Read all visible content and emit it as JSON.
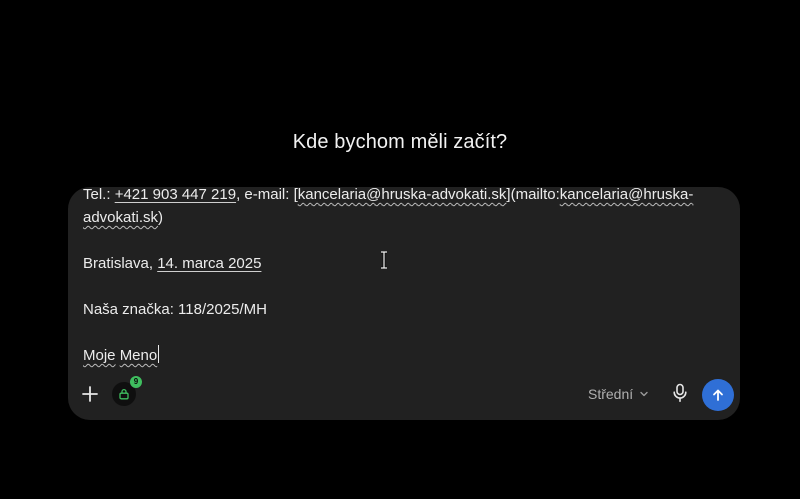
{
  "heading": "Kde bychom měli začít?",
  "composer": {
    "line1": {
      "prefix": "Tel.: ",
      "phone": "+421 903 447 219",
      "middle": ", e-mail: [",
      "email1": "kancelaria@hruska-advokati.sk",
      "bracket": "](mailto:",
      "email2a": "kancelaria@hruska-"
    },
    "line2": {
      "email2b": "advokati.sk",
      "suffix": ")"
    },
    "line3": {
      "city": "Bratislava, ",
      "date": "14. marca 2025"
    },
    "line4": "Naša značka: 118/2025/MH",
    "line5": {
      "word1": "Moje",
      "space": " ",
      "word2": "Meno"
    }
  },
  "toolbar": {
    "tool_badge": "9",
    "model_label": "Střední",
    "icons": {
      "plus": "plus-icon",
      "tool": "lock-icon",
      "model": "chevron-down-icon",
      "mic": "microphone-icon",
      "send": "arrow-up-icon"
    }
  },
  "colors": {
    "background": "#000000",
    "composer": "#212121",
    "send": "#2f6fd6",
    "badge": "#3fbf5f"
  }
}
